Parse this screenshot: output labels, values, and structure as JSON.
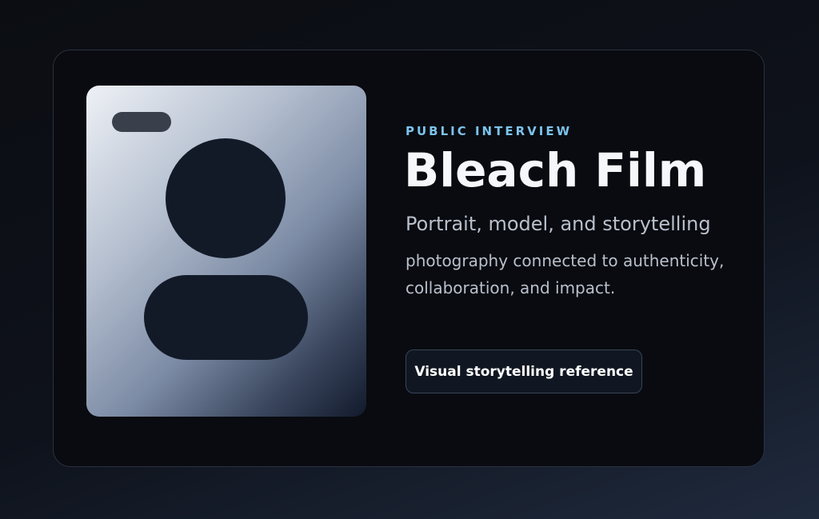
{
  "card": {
    "eyebrow": "PUBLIC INTERVIEW",
    "title": "Bleach Film",
    "subtitle": "Portrait, model, and storytelling",
    "description": "photography connected to authenticity, collaboration, and impact.",
    "cta_label": "Visual storytelling reference"
  },
  "portrait": {
    "icon": "person-placeholder-icon"
  },
  "colors": {
    "accent": "#7cc3ec",
    "card_background": "#090b10",
    "title": "#f5f7fb",
    "text": "#b9c0cc"
  }
}
